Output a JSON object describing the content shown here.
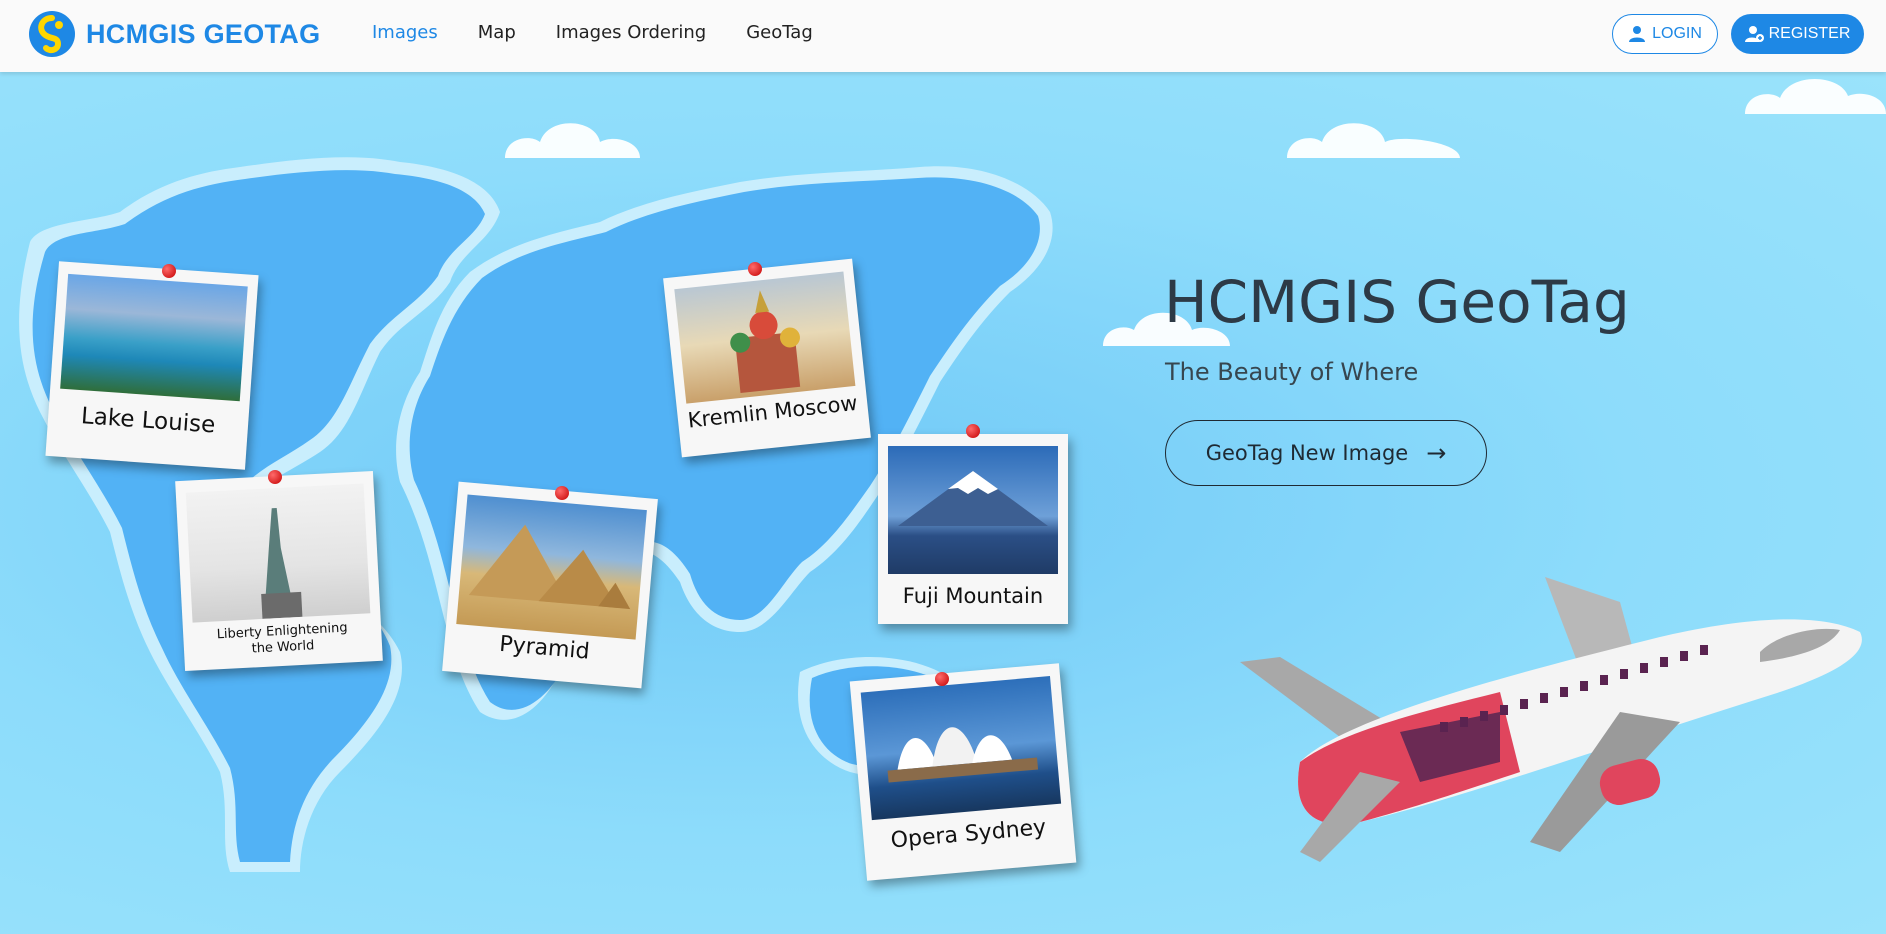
{
  "brand": {
    "name": "HCMGIS GEOTAG"
  },
  "nav": {
    "items": [
      {
        "label": "Images",
        "active": true
      },
      {
        "label": "Map",
        "active": false
      },
      {
        "label": "Images Ordering",
        "active": false
      },
      {
        "label": "GeoTag",
        "active": false
      }
    ],
    "login_label": "LOGIN",
    "register_label": "REGISTER"
  },
  "hero": {
    "title": "HCMGIS GeoTag",
    "subtitle": "The Beauty of Where",
    "cta_label": "GeoTag New Image",
    "cta_icon": "arrow-right-icon"
  },
  "photos": [
    {
      "caption": "Lake Louise"
    },
    {
      "caption": "Liberty Enlightening the World"
    },
    {
      "caption": "Pyramid"
    },
    {
      "caption": "Kremlin Moscow"
    },
    {
      "caption": "Fuji Mountain"
    },
    {
      "caption": "Opera Sydney"
    }
  ],
  "colors": {
    "accent": "#1e88e5",
    "sky": "#8ddcfb",
    "land": "#52b2f5",
    "pin": "#d40000"
  }
}
